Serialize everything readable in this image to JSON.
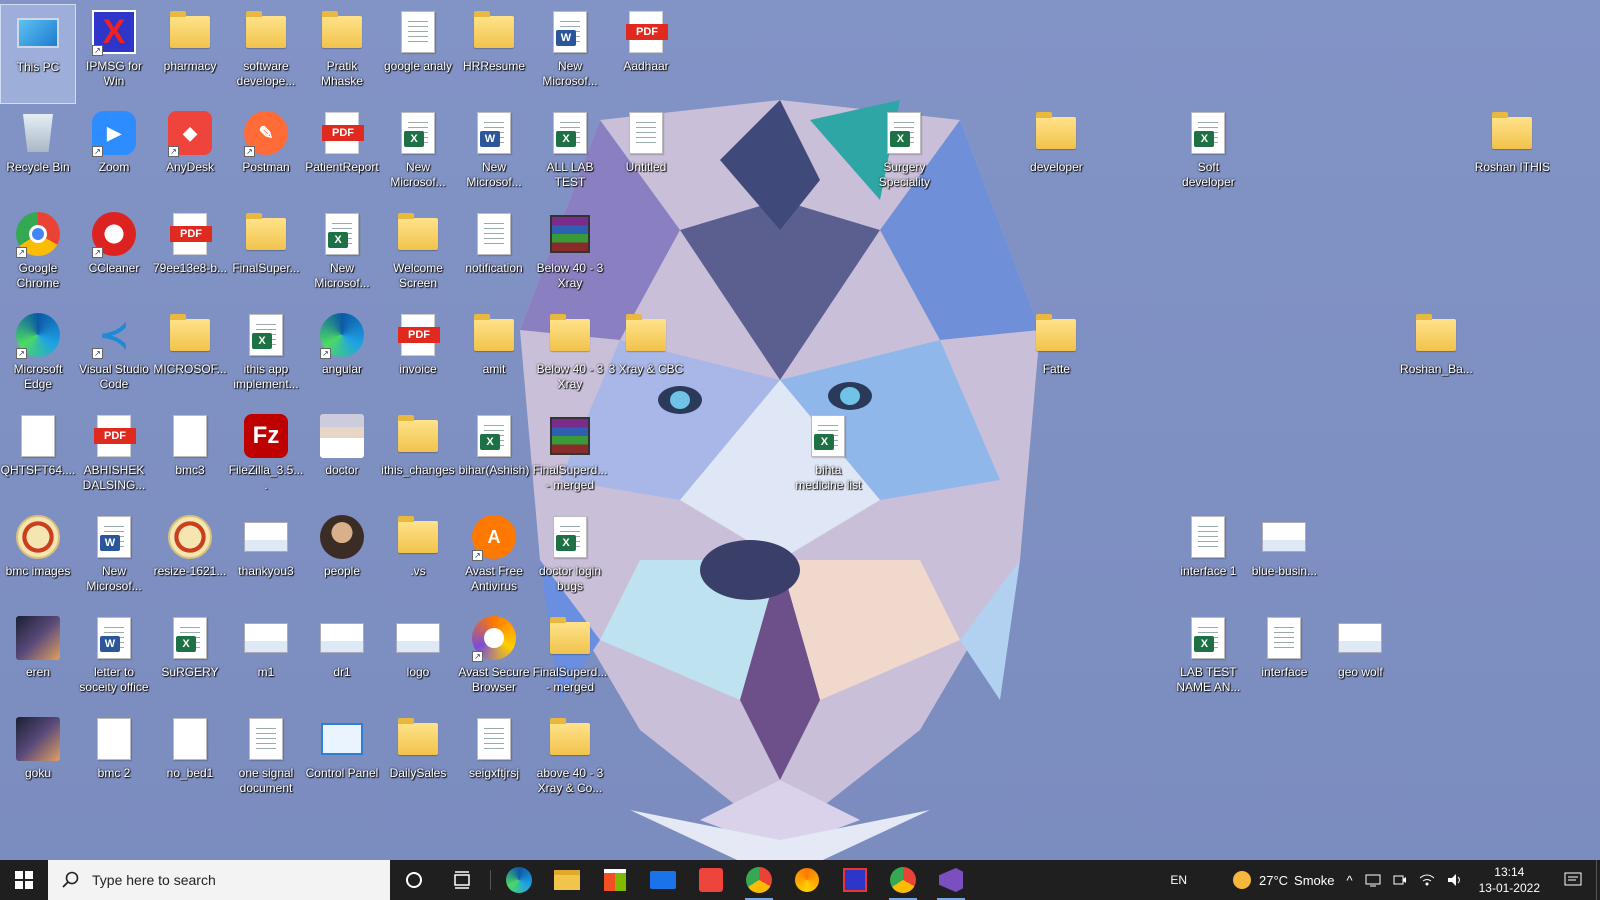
{
  "desktop": {
    "icons": [
      {
        "label": "This PC",
        "kind": "pc"
      },
      {
        "label": "IPMSG for Win",
        "kind": "ipmsg"
      },
      {
        "label": "pharmacy",
        "kind": "folder"
      },
      {
        "label": "software develope...",
        "kind": "folder"
      },
      {
        "label": "Pratik Mhaske",
        "kind": "folder"
      },
      {
        "label": "google analy",
        "kind": "doc"
      },
      {
        "label": "HRResume",
        "kind": "folder"
      },
      {
        "label": "New Microsof...",
        "kind": "word"
      },
      {
        "label": "Aadhaar",
        "kind": "pdf"
      },
      {
        "label": "Recycle Bin",
        "kind": "bin"
      },
      {
        "label": "Zoom",
        "kind": "zoom"
      },
      {
        "label": "AnyDesk",
        "kind": "anydesk"
      },
      {
        "label": "Postman",
        "kind": "postman"
      },
      {
        "label": "PatientReport",
        "kind": "pdf"
      },
      {
        "label": "New Microsof...",
        "kind": "excel"
      },
      {
        "label": "New Microsof...",
        "kind": "word"
      },
      {
        "label": "ALL LAB TEST (BARCODE)...",
        "kind": "excel"
      },
      {
        "label": "Untitled",
        "kind": "doc"
      },
      {
        "label": "Surgery Speciality",
        "kind": "excel"
      },
      {
        "label": "developer",
        "kind": "folder"
      },
      {
        "label": "Soft developer",
        "kind": "excel"
      },
      {
        "label": "Roshan ITHIS",
        "kind": "folder"
      },
      {
        "label": "Google Chrome",
        "kind": "chrome"
      },
      {
        "label": "CCleaner",
        "kind": "ccleaner"
      },
      {
        "label": "79ee13e8-b...",
        "kind": "pdf"
      },
      {
        "label": "FinalSuper...",
        "kind": "folder"
      },
      {
        "label": "New Microsof...",
        "kind": "excel"
      },
      {
        "label": "Welcome Screen",
        "kind": "folder"
      },
      {
        "label": "notification",
        "kind": "doc"
      },
      {
        "label": "Below 40 - 3 Xray",
        "kind": "rar"
      },
      {
        "label": "Microsoft Edge",
        "kind": "edge"
      },
      {
        "label": "Visual Studio Code",
        "kind": "vscode"
      },
      {
        "label": "MICROSOF...",
        "kind": "folder"
      },
      {
        "label": "ithis app implement...",
        "kind": "excel"
      },
      {
        "label": "angular",
        "kind": "edge"
      },
      {
        "label": "invoice",
        "kind": "pdf"
      },
      {
        "label": "amit",
        "kind": "folder"
      },
      {
        "label": "Below 40 - 3 Xray",
        "kind": "folder"
      },
      {
        "label": "3 Xray & CBC",
        "kind": "folder"
      },
      {
        "label": "Fatte",
        "kind": "folder"
      },
      {
        "label": "Roshan_Ba...",
        "kind": "folder"
      },
      {
        "label": "QHTSFT64....",
        "kind": "blank"
      },
      {
        "label": "ABHISHEK DALSING...",
        "kind": "pdf"
      },
      {
        "label": "bmc3",
        "kind": "blank"
      },
      {
        "label": "FileZilla_3.5....",
        "kind": "filezilla"
      },
      {
        "label": "doctor",
        "kind": "photo-doctor"
      },
      {
        "label": "ithis_changes",
        "kind": "folder"
      },
      {
        "label": "bihar(Ashish)",
        "kind": "excel"
      },
      {
        "label": "FinalSuperd... - merged",
        "kind": "rar"
      },
      {
        "label": "bihta medicine list",
        "kind": "excel"
      },
      {
        "label": "bmc images",
        "kind": "seal"
      },
      {
        "label": "New Microsof...",
        "kind": "word"
      },
      {
        "label": "resize-1621...",
        "kind": "seal"
      },
      {
        "label": "thankyou3",
        "kind": "img-small"
      },
      {
        "label": "people",
        "kind": "photo-people"
      },
      {
        "label": ".vs",
        "kind": "folder"
      },
      {
        "label": "Avast Free Antivirus",
        "kind": "avast"
      },
      {
        "label": "doctor login bugs",
        "kind": "excel"
      },
      {
        "label": "interface 1",
        "kind": "doc"
      },
      {
        "label": "blue-busin...",
        "kind": "img-small"
      },
      {
        "label": "eren",
        "kind": "photo-dark"
      },
      {
        "label": "letter to soceity office",
        "kind": "word"
      },
      {
        "label": "SuRGERY",
        "kind": "excel"
      },
      {
        "label": "m1",
        "kind": "img-small"
      },
      {
        "label": "dr1",
        "kind": "img-small"
      },
      {
        "label": "logo",
        "kind": "img-small"
      },
      {
        "label": "Avast Secure Browser",
        "kind": "avastsb"
      },
      {
        "label": "FinalSuperd... - merged",
        "kind": "folder"
      },
      {
        "label": "LAB TEST NAME AN...",
        "kind": "excel"
      },
      {
        "label": "interface",
        "kind": "doc"
      },
      {
        "label": "geo wolf",
        "kind": "img-small"
      },
      {
        "label": "goku",
        "kind": "photo-dark"
      },
      {
        "label": "bmc 2",
        "kind": "blank"
      },
      {
        "label": "no_bed1",
        "kind": "blank"
      },
      {
        "label": "one signal document",
        "kind": "doc"
      },
      {
        "label": "Control Panel",
        "kind": "controlpanel"
      },
      {
        "label": "DailySales",
        "kind": "folder"
      },
      {
        "label": "seigxftjrsj",
        "kind": "doc"
      },
      {
        "label": "above 40 - 3 Xray & Co...",
        "kind": "folder"
      }
    ]
  },
  "taskbar": {
    "search_placeholder": "Type here to search",
    "pinned": [
      "start-icon",
      "cortana-icon",
      "task-view-icon",
      "edge-icon",
      "file-explorer-icon",
      "store-icon",
      "mail-icon",
      "anydesk-icon",
      "chrome-icon",
      "avast-browser-icon",
      "ipmsg-icon",
      "chrome-profile-icon",
      "visual-studio-icon"
    ],
    "language": "EN",
    "weather_temp": "27°C",
    "weather_desc": "Smoke",
    "time": "13:14",
    "date": "13-01-2022"
  },
  "colors": {
    "desktop_bg": "#7f8fc0",
    "taskbar_bg": "#1f1f1f",
    "folder": "#f1c34c",
    "excel": "#1e7145",
    "word": "#2b579a",
    "pdf": "#e02a20"
  }
}
